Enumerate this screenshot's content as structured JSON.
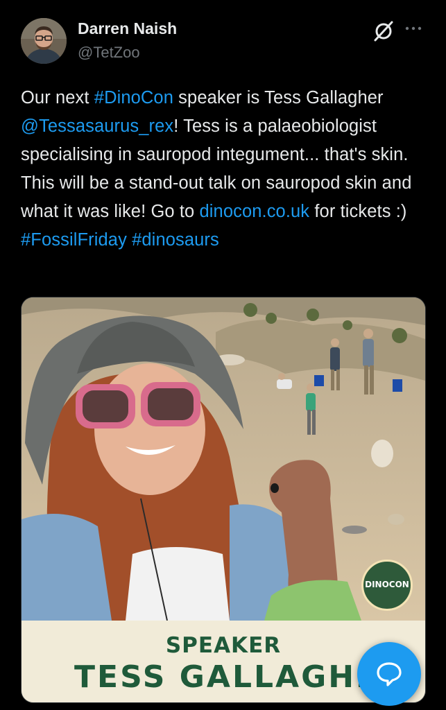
{
  "author": {
    "name": "Darren Naish",
    "handle": "@TetZoo",
    "avatar_icon": "profile-photo"
  },
  "header_icons": [
    "grok-icon",
    "more-options-icon"
  ],
  "tweet": {
    "segments": [
      {
        "text": "Our next ",
        "type": "text"
      },
      {
        "text": "#DinoCon",
        "type": "hashtag"
      },
      {
        "text": " speaker is Tess Gallagher ",
        "type": "text"
      },
      {
        "text": "@Tessasaurus_rex",
        "type": "mention"
      },
      {
        "text": "! Tess is a palaeobiologist specialising in sauropod integument... that's skin. This will be a stand-out talk on sauropod skin and what it was like! Go to ",
        "type": "text"
      },
      {
        "text": "dinocon.co.uk",
        "type": "link"
      },
      {
        "text": " for tickets :) ",
        "type": "text"
      },
      {
        "text": "#FossilFriday",
        "type": "hashtag"
      },
      {
        "text": " ",
        "type": "text"
      },
      {
        "text": "#dinosaurs",
        "type": "hashtag"
      }
    ]
  },
  "media": {
    "banner_subtitle": "SPEAKER",
    "banner_title": "TESS GALLAGHER",
    "badge_text": "DINOCON"
  },
  "colors": {
    "background": "#000000",
    "text": "#e7e9ea",
    "muted": "#71767b",
    "link": "#1d9bf0",
    "banner_green": "#1f5a3a",
    "banner_bg": "#f1ebd8"
  },
  "fab": {
    "icon": "chat-bubble-icon"
  }
}
